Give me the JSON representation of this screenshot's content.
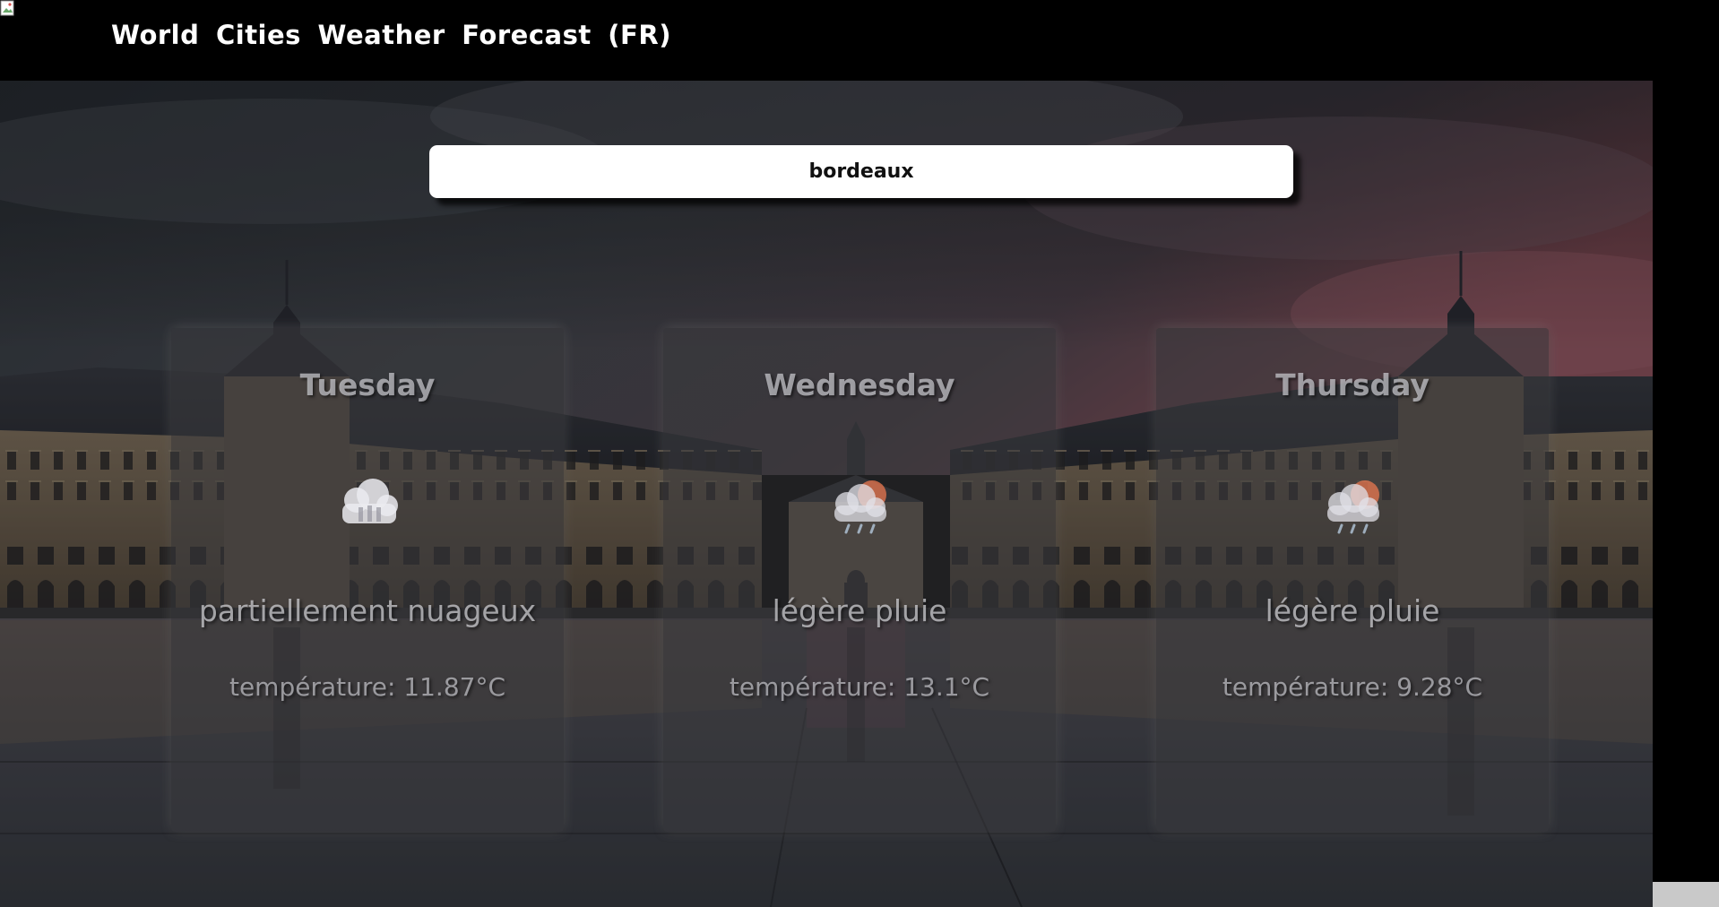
{
  "header": {
    "title": "World Cities Weather Forecast (FR)"
  },
  "search": {
    "value": "bordeaux"
  },
  "forecast": [
    {
      "day": "Tuesday",
      "icon": "partly-cloudy-icon",
      "description": "partiellement nuageux",
      "temperature": "température: 11.87°C"
    },
    {
      "day": "Wednesday",
      "icon": "light-rain-icon",
      "description": "légère pluie",
      "temperature": "température: 13.1°C"
    },
    {
      "day": "Thursday",
      "icon": "light-rain-icon",
      "description": "légère pluie",
      "temperature": "température: 9.28°C"
    }
  ],
  "colors": {
    "header_bg": "#000000",
    "search_bg": "#ffffff",
    "sky_top": "#3e4650",
    "sky_dusk": "#b06a78",
    "water": "#5b5d66"
  }
}
